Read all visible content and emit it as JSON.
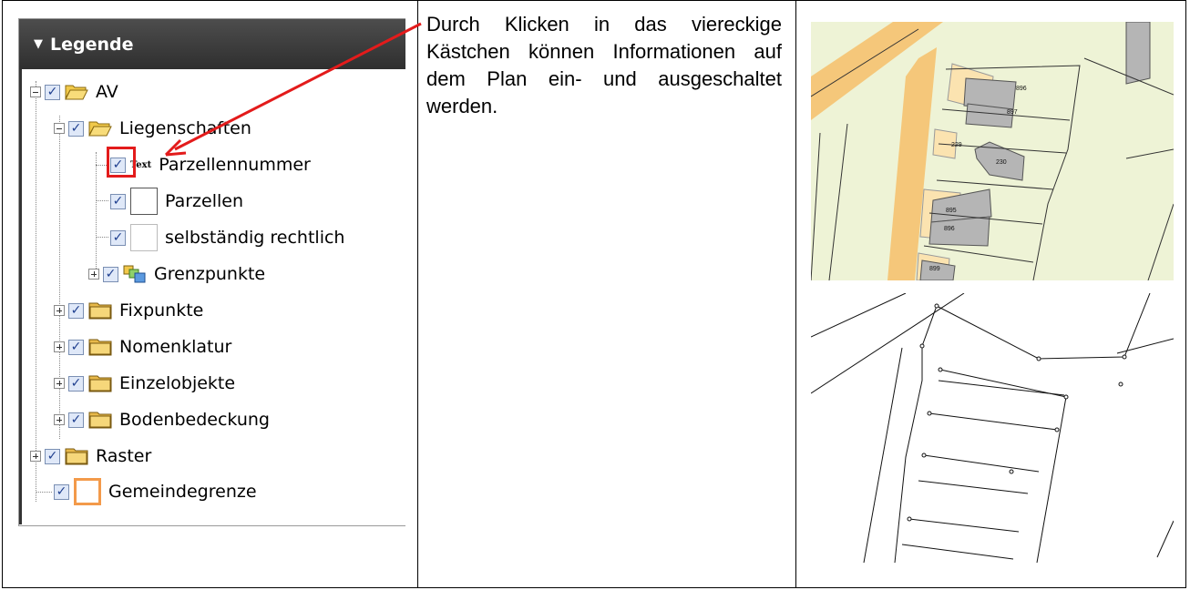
{
  "legend": {
    "title": "Legende",
    "items": [
      {
        "label": "AV"
      },
      {
        "label": "Liegenschaften"
      },
      {
        "label": "Parzellennummer",
        "icon_text": "Text"
      },
      {
        "label": "Parzellen"
      },
      {
        "label": "selbständig rechtlich"
      },
      {
        "label": "Grenzpunkte"
      },
      {
        "label": "Fixpunkte"
      },
      {
        "label": "Nomenklatur"
      },
      {
        "label": "Einzelobjekte"
      },
      {
        "label": "Bodenbedeckung"
      },
      {
        "label": "Raster"
      },
      {
        "label": "Gemeindegrenze"
      }
    ]
  },
  "description": "Durch Klicken in das viereckige Kästchen können Informationen auf dem Plan ein- und ausgeschaltet werden.",
  "map_labels": [
    "896",
    "897",
    "229",
    "230",
    "895",
    "896",
    "899"
  ],
  "colors": {
    "highlight": "#e31b1b",
    "checkbox_check": "#1f3f8f",
    "map_background": "#eef3d6",
    "road": "#f5c77a",
    "building": "#b5b5b5",
    "boundary_orange": "#f39a4a"
  }
}
